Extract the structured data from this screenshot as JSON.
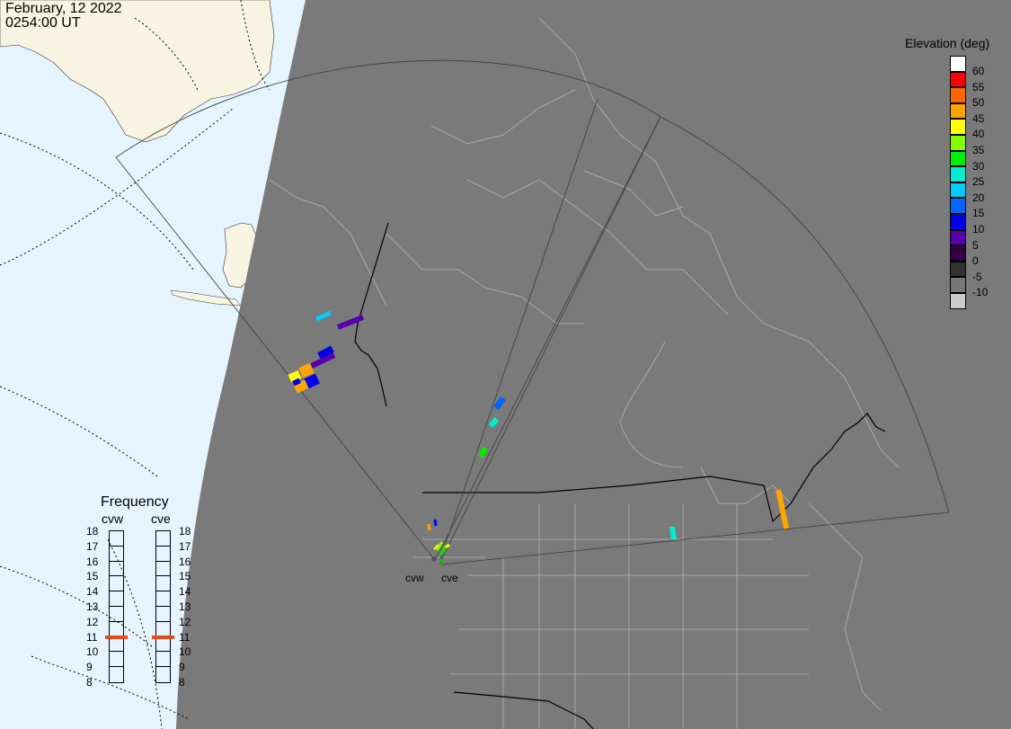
{
  "header": {
    "date": "February, 12 2022",
    "time": "0254:00 UT"
  },
  "elevation_legend": {
    "title": "Elevation (deg)",
    "levels": [
      {
        "label": "60",
        "color": "#ffffff"
      },
      {
        "label": "55",
        "color": "#ff0000"
      },
      {
        "label": "50",
        "color": "#ff6600"
      },
      {
        "label": "45",
        "color": "#ffa500"
      },
      {
        "label": "40",
        "color": "#ffff00"
      },
      {
        "label": "35",
        "color": "#88ff00"
      },
      {
        "label": "30",
        "color": "#00ee00"
      },
      {
        "label": "25",
        "color": "#00eecc"
      },
      {
        "label": "20",
        "color": "#00ccff"
      },
      {
        "label": "15",
        "color": "#0066ff"
      },
      {
        "label": "10",
        "color": "#0000ee"
      },
      {
        "label": "5",
        "color": "#5500aa"
      },
      {
        "label": "0",
        "color": "#330044"
      },
      {
        "label": "-5",
        "color": "#333333"
      },
      {
        "label": "-10",
        "color": "#777777"
      },
      {
        "label": "",
        "color": "#cccccc"
      }
    ]
  },
  "frequency": {
    "title": "Frequency",
    "radars": [
      {
        "name": "cvw",
        "current": 10.9
      },
      {
        "name": "cve",
        "current": 10.9
      }
    ],
    "ticks": [
      "18",
      "17",
      "16",
      "15",
      "14",
      "13",
      "12",
      "11",
      "10",
      "9",
      "8"
    ]
  },
  "radars": [
    {
      "name": "cvw"
    },
    {
      "name": "cve"
    }
  ],
  "colors": {
    "night": "#7a7a7a",
    "ocean_day": "#e6f4ff",
    "land_day": "#f8f4e2",
    "border": "#000000"
  }
}
